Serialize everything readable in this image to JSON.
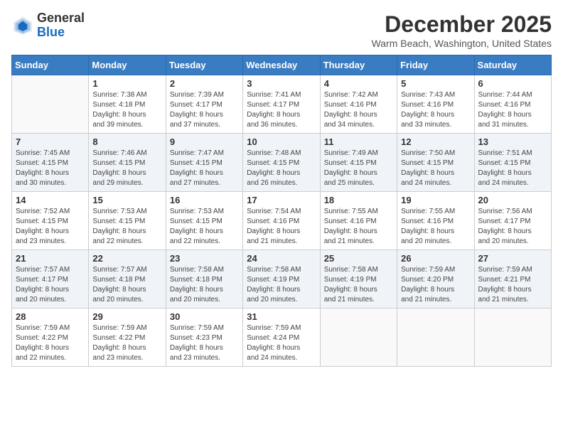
{
  "header": {
    "logo_general": "General",
    "logo_blue": "Blue",
    "month_title": "December 2025",
    "location": "Warm Beach, Washington, United States"
  },
  "days_of_week": [
    "Sunday",
    "Monday",
    "Tuesday",
    "Wednesday",
    "Thursday",
    "Friday",
    "Saturday"
  ],
  "weeks": [
    [
      {
        "day": "",
        "content": ""
      },
      {
        "day": "1",
        "content": "Sunrise: 7:38 AM\nSunset: 4:18 PM\nDaylight: 8 hours\nand 39 minutes."
      },
      {
        "day": "2",
        "content": "Sunrise: 7:39 AM\nSunset: 4:17 PM\nDaylight: 8 hours\nand 37 minutes."
      },
      {
        "day": "3",
        "content": "Sunrise: 7:41 AM\nSunset: 4:17 PM\nDaylight: 8 hours\nand 36 minutes."
      },
      {
        "day": "4",
        "content": "Sunrise: 7:42 AM\nSunset: 4:16 PM\nDaylight: 8 hours\nand 34 minutes."
      },
      {
        "day": "5",
        "content": "Sunrise: 7:43 AM\nSunset: 4:16 PM\nDaylight: 8 hours\nand 33 minutes."
      },
      {
        "day": "6",
        "content": "Sunrise: 7:44 AM\nSunset: 4:16 PM\nDaylight: 8 hours\nand 31 minutes."
      }
    ],
    [
      {
        "day": "7",
        "content": "Sunrise: 7:45 AM\nSunset: 4:15 PM\nDaylight: 8 hours\nand 30 minutes."
      },
      {
        "day": "8",
        "content": "Sunrise: 7:46 AM\nSunset: 4:15 PM\nDaylight: 8 hours\nand 29 minutes."
      },
      {
        "day": "9",
        "content": "Sunrise: 7:47 AM\nSunset: 4:15 PM\nDaylight: 8 hours\nand 27 minutes."
      },
      {
        "day": "10",
        "content": "Sunrise: 7:48 AM\nSunset: 4:15 PM\nDaylight: 8 hours\nand 26 minutes."
      },
      {
        "day": "11",
        "content": "Sunrise: 7:49 AM\nSunset: 4:15 PM\nDaylight: 8 hours\nand 25 minutes."
      },
      {
        "day": "12",
        "content": "Sunrise: 7:50 AM\nSunset: 4:15 PM\nDaylight: 8 hours\nand 24 minutes."
      },
      {
        "day": "13",
        "content": "Sunrise: 7:51 AM\nSunset: 4:15 PM\nDaylight: 8 hours\nand 24 minutes."
      }
    ],
    [
      {
        "day": "14",
        "content": "Sunrise: 7:52 AM\nSunset: 4:15 PM\nDaylight: 8 hours\nand 23 minutes."
      },
      {
        "day": "15",
        "content": "Sunrise: 7:53 AM\nSunset: 4:15 PM\nDaylight: 8 hours\nand 22 minutes."
      },
      {
        "day": "16",
        "content": "Sunrise: 7:53 AM\nSunset: 4:15 PM\nDaylight: 8 hours\nand 22 minutes."
      },
      {
        "day": "17",
        "content": "Sunrise: 7:54 AM\nSunset: 4:16 PM\nDaylight: 8 hours\nand 21 minutes."
      },
      {
        "day": "18",
        "content": "Sunrise: 7:55 AM\nSunset: 4:16 PM\nDaylight: 8 hours\nand 21 minutes."
      },
      {
        "day": "19",
        "content": "Sunrise: 7:55 AM\nSunset: 4:16 PM\nDaylight: 8 hours\nand 20 minutes."
      },
      {
        "day": "20",
        "content": "Sunrise: 7:56 AM\nSunset: 4:17 PM\nDaylight: 8 hours\nand 20 minutes."
      }
    ],
    [
      {
        "day": "21",
        "content": "Sunrise: 7:57 AM\nSunset: 4:17 PM\nDaylight: 8 hours\nand 20 minutes."
      },
      {
        "day": "22",
        "content": "Sunrise: 7:57 AM\nSunset: 4:18 PM\nDaylight: 8 hours\nand 20 minutes."
      },
      {
        "day": "23",
        "content": "Sunrise: 7:58 AM\nSunset: 4:18 PM\nDaylight: 8 hours\nand 20 minutes."
      },
      {
        "day": "24",
        "content": "Sunrise: 7:58 AM\nSunset: 4:19 PM\nDaylight: 8 hours\nand 20 minutes."
      },
      {
        "day": "25",
        "content": "Sunrise: 7:58 AM\nSunset: 4:19 PM\nDaylight: 8 hours\nand 21 minutes."
      },
      {
        "day": "26",
        "content": "Sunrise: 7:59 AM\nSunset: 4:20 PM\nDaylight: 8 hours\nand 21 minutes."
      },
      {
        "day": "27",
        "content": "Sunrise: 7:59 AM\nSunset: 4:21 PM\nDaylight: 8 hours\nand 21 minutes."
      }
    ],
    [
      {
        "day": "28",
        "content": "Sunrise: 7:59 AM\nSunset: 4:22 PM\nDaylight: 8 hours\nand 22 minutes."
      },
      {
        "day": "29",
        "content": "Sunrise: 7:59 AM\nSunset: 4:22 PM\nDaylight: 8 hours\nand 23 minutes."
      },
      {
        "day": "30",
        "content": "Sunrise: 7:59 AM\nSunset: 4:23 PM\nDaylight: 8 hours\nand 23 minutes."
      },
      {
        "day": "31",
        "content": "Sunrise: 7:59 AM\nSunset: 4:24 PM\nDaylight: 8 hours\nand 24 minutes."
      },
      {
        "day": "",
        "content": ""
      },
      {
        "day": "",
        "content": ""
      },
      {
        "day": "",
        "content": ""
      }
    ]
  ]
}
